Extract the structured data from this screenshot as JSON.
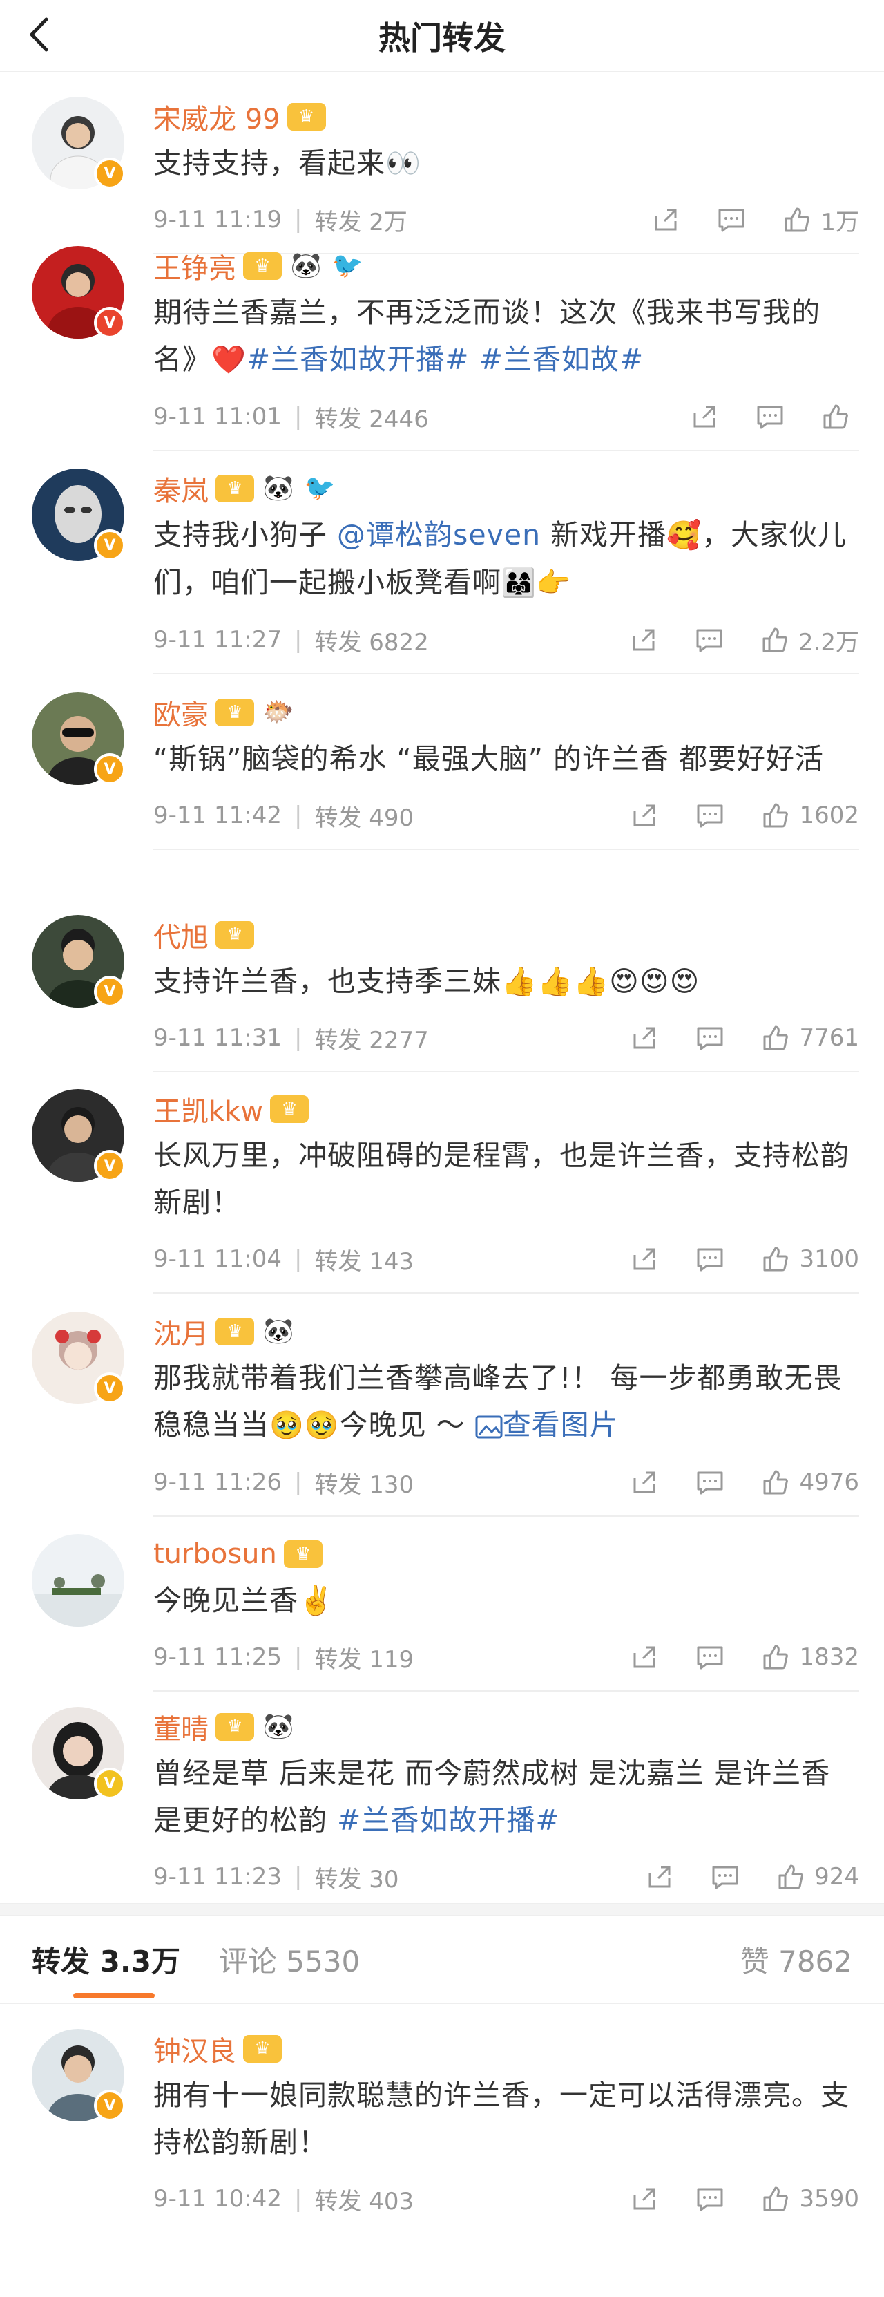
{
  "header": {
    "title": "热门转发"
  },
  "posts": [
    {
      "name": "宋威龙 99",
      "content": "支持支持，看起来👀",
      "time": "9-11 11:19",
      "forward": "转发 2万",
      "likes": "1万"
    },
    {
      "name": "王铮亮",
      "content_parts": [
        "期待兰香嘉兰，不再泛泛而谈！这次《我来书写我的名》",
        "❤️",
        "#兰香如故开播#",
        " ",
        "#兰香如故#"
      ],
      "time": "9-11 11:01",
      "forward": "转发 2446",
      "likes": ""
    },
    {
      "name": "秦岚",
      "content_parts": [
        "支持我小狗子 ",
        "@谭松韵seven",
        " 新戏开播",
        "🥰",
        "，大家伙儿们，咱们一起搬小板凳看啊",
        "👨‍👩‍👧",
        "👉"
      ],
      "time": "9-11 11:27",
      "forward": "转发 6822",
      "likes": "2.2万"
    },
    {
      "name": "欧豪",
      "content": "“斯锅”脑袋的希水 “最强大脑” 的许兰香 都要好好活",
      "time": "9-11 11:42",
      "forward": "转发 490",
      "likes": "1602"
    },
    {
      "name": "代旭",
      "content": "支持许兰香，也支持季三妹👍👍👍😍😍😍",
      "time": "9-11 11:31",
      "forward": "转发 2277",
      "likes": "7761"
    },
    {
      "name": "王凯kkw",
      "content": "长风万里，冲破阻碍的是程霄，也是许兰香，支持松韵新剧！",
      "time": "9-11 11:04",
      "forward": "转发 143",
      "likes": "3100"
    },
    {
      "name": "沈月",
      "content_parts": [
        "那我就带着我们兰香攀高峰去了!！ 每一步都勇敢无畏稳稳当当",
        "🥹🥹",
        "今晚见 ～ ",
        "查看图片"
      ],
      "time": "9-11 11:26",
      "forward": "转发 130",
      "likes": "4976"
    },
    {
      "name": "turbosun",
      "content": "今晚见兰香✌️",
      "time": "9-11 11:25",
      "forward": "转发 119",
      "likes": "1832"
    },
    {
      "name": "董晴",
      "content_parts": [
        "曾经是草 后来是花 而今蔚然成树 是沈嘉兰 是许兰香 是更好的松韵 ",
        "#兰香如故开播#"
      ],
      "time": "9-11 11:23",
      "forward": "转发 30",
      "likes": "924"
    }
  ],
  "tabs": {
    "forward": "转发 3.3万",
    "comments": "评论 5530",
    "likes": "赞 7862"
  },
  "bottom_post": {
    "name": "钟汉良",
    "content": "拥有十一娘同款聪慧的许兰香，一定可以活得漂亮。支持松韵新剧！",
    "time": "9-11 10:42",
    "forward": "转发 403",
    "likes": "3590"
  },
  "colors": {
    "username": "#e8733a",
    "link": "#3a6eb8",
    "accent": "#f7792c",
    "meta": "#999999"
  },
  "icons": [
    "back-arrow-icon",
    "share-icon",
    "comment-icon",
    "like-icon",
    "crown-badge-icon",
    "panda-badge-icon",
    "verified-badge-icon",
    "image-icon"
  ]
}
